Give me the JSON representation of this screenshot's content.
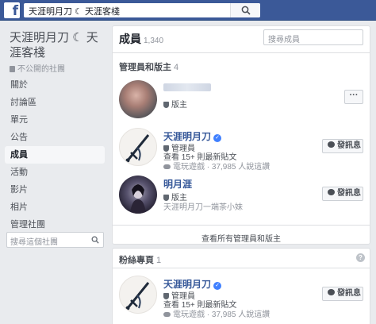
{
  "topbar": {
    "logo": "f",
    "search_value": "天涯明月刀 ☾ 天涯客棧"
  },
  "sidebar": {
    "group_title": "天涯明月刀 ☾ 天涯客棧",
    "privacy": "不公開的社團",
    "items": [
      {
        "label": "關於"
      },
      {
        "label": "討論區"
      },
      {
        "label": "單元"
      },
      {
        "label": "公告"
      },
      {
        "label": "成員"
      },
      {
        "label": "活動"
      },
      {
        "label": "影片"
      },
      {
        "label": "相片"
      },
      {
        "label": "管理社團"
      }
    ],
    "search_placeholder": "搜尋這個社團"
  },
  "members_card": {
    "title": "成員",
    "count": "1,340",
    "search_placeholder": "搜尋成員",
    "admins_section": {
      "title": "管理員和版主",
      "count": "4"
    },
    "members": [
      {
        "role": "版主",
        "more": "···"
      },
      {
        "name": "天涯明月刀",
        "role": "管理員",
        "posts": "查看 15+ 則最新貼文",
        "meta": "電玩遊戲 · 37,985 人說這讚",
        "button": "發訊息"
      },
      {
        "name": "明月涯",
        "role": "版主",
        "meta": "天涯明月刀一端茶小妹",
        "button": "發訊息"
      }
    ],
    "see_all": "查看所有管理員和版主"
  },
  "fans_card": {
    "title": "粉絲專頁",
    "count": "1",
    "info": "?",
    "member": {
      "name": "天涯明月刀",
      "role": "管理員",
      "posts": "查看 15+ 則最新貼文",
      "meta": "電玩遊戲 · 37,985 人說這讚",
      "button": "發訊息"
    }
  },
  "colors": {
    "topbar": "#3b5998",
    "link": "#365899",
    "verified": "#4080ff"
  }
}
